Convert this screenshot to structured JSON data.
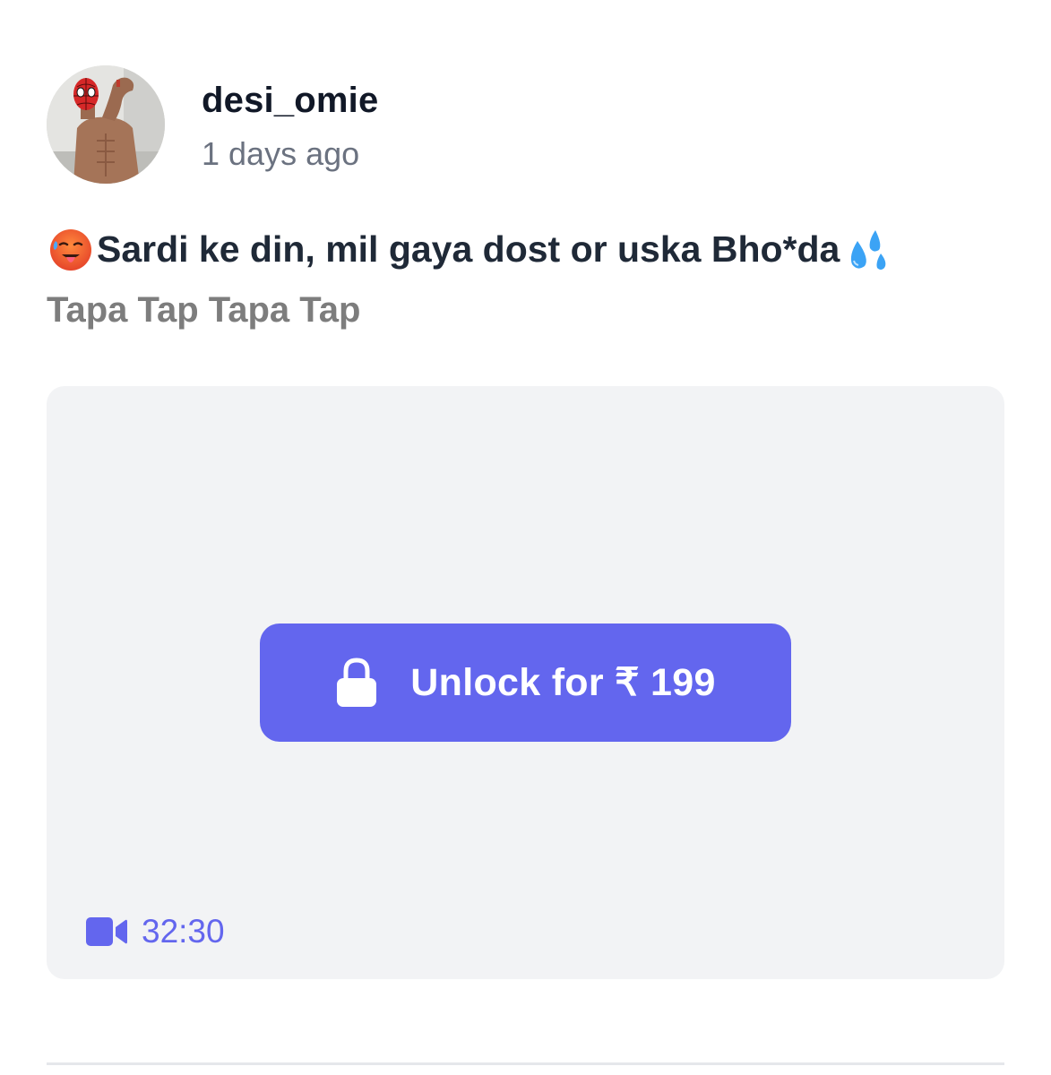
{
  "post": {
    "author": {
      "username": "desi_omie",
      "time_ago": "1 days ago",
      "avatar_icon": "avatar-photo"
    },
    "caption": {
      "leading_emoji_icon": "hot-face-emoji",
      "text": "Sardi ke din, mil gaya dost or uska Bho*da",
      "trailing_emoji_icon": "sweat-droplets-emoji"
    },
    "subtitle": "Tapa Tap Tapa Tap",
    "media": {
      "locked": true,
      "unlock_label": "Unlock for ₹ 199",
      "lock_icon": "lock-icon",
      "video_icon": "video-camera-icon",
      "duration": "32:30"
    }
  },
  "colors": {
    "accent": "#6366ee",
    "card_background": "#f2f3f5",
    "username": "#111827",
    "timestamp": "#6b7280",
    "subtitle": "#7d7d7d"
  }
}
